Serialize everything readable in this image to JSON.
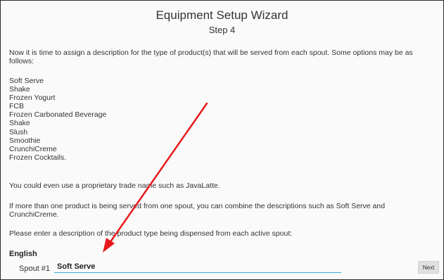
{
  "wizard": {
    "title": "Equipment Setup Wizard",
    "step": "Step 4"
  },
  "content": {
    "intro": "Now it is time to assign a description for the type of product(s) that will be served from each spout.  Some options may be as follows:",
    "options": [
      "Soft Serve",
      "Shake",
      "Frozen Yogurt",
      "FCB",
      "Frozen Carbonated Beverage",
      "Shake",
      "Slush",
      "Smoothie",
      "CrunchiCreme",
      "Frozen Cocktails."
    ],
    "trade_name_note": "You could even use a proprietary trade name such as JavaLatte.",
    "combine_note": "If more than one product is being served from one spout, you can combine the descriptions such as Soft Serve and CrunchiCreme.",
    "enter_prompt": "Please enter a description of the product type being dispensed from each active spout:"
  },
  "form": {
    "language_label": "English",
    "spout1_label": "Spout #1",
    "spout1_value": "Soft Serve",
    "next_label": "Next"
  },
  "annotation": {
    "arrow_color": "#e8191c"
  }
}
